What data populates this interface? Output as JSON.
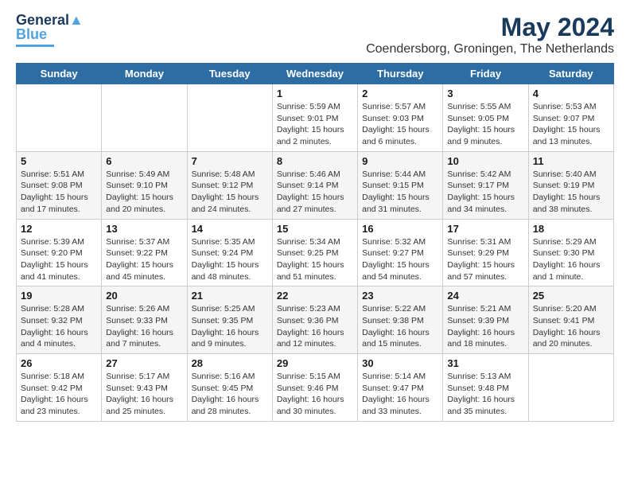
{
  "logo": {
    "line1": "General",
    "line2": "Blue"
  },
  "title": "May 2024",
  "subtitle": "Coendersborg, Groningen, The Netherlands",
  "days_of_week": [
    "Sunday",
    "Monday",
    "Tuesday",
    "Wednesday",
    "Thursday",
    "Friday",
    "Saturday"
  ],
  "weeks": [
    [
      {
        "day": "",
        "info": ""
      },
      {
        "day": "",
        "info": ""
      },
      {
        "day": "",
        "info": ""
      },
      {
        "day": "1",
        "info": "Sunrise: 5:59 AM\nSunset: 9:01 PM\nDaylight: 15 hours\nand 2 minutes."
      },
      {
        "day": "2",
        "info": "Sunrise: 5:57 AM\nSunset: 9:03 PM\nDaylight: 15 hours\nand 6 minutes."
      },
      {
        "day": "3",
        "info": "Sunrise: 5:55 AM\nSunset: 9:05 PM\nDaylight: 15 hours\nand 9 minutes."
      },
      {
        "day": "4",
        "info": "Sunrise: 5:53 AM\nSunset: 9:07 PM\nDaylight: 15 hours\nand 13 minutes."
      }
    ],
    [
      {
        "day": "5",
        "info": "Sunrise: 5:51 AM\nSunset: 9:08 PM\nDaylight: 15 hours\nand 17 minutes."
      },
      {
        "day": "6",
        "info": "Sunrise: 5:49 AM\nSunset: 9:10 PM\nDaylight: 15 hours\nand 20 minutes."
      },
      {
        "day": "7",
        "info": "Sunrise: 5:48 AM\nSunset: 9:12 PM\nDaylight: 15 hours\nand 24 minutes."
      },
      {
        "day": "8",
        "info": "Sunrise: 5:46 AM\nSunset: 9:14 PM\nDaylight: 15 hours\nand 27 minutes."
      },
      {
        "day": "9",
        "info": "Sunrise: 5:44 AM\nSunset: 9:15 PM\nDaylight: 15 hours\nand 31 minutes."
      },
      {
        "day": "10",
        "info": "Sunrise: 5:42 AM\nSunset: 9:17 PM\nDaylight: 15 hours\nand 34 minutes."
      },
      {
        "day": "11",
        "info": "Sunrise: 5:40 AM\nSunset: 9:19 PM\nDaylight: 15 hours\nand 38 minutes."
      }
    ],
    [
      {
        "day": "12",
        "info": "Sunrise: 5:39 AM\nSunset: 9:20 PM\nDaylight: 15 hours\nand 41 minutes."
      },
      {
        "day": "13",
        "info": "Sunrise: 5:37 AM\nSunset: 9:22 PM\nDaylight: 15 hours\nand 45 minutes."
      },
      {
        "day": "14",
        "info": "Sunrise: 5:35 AM\nSunset: 9:24 PM\nDaylight: 15 hours\nand 48 minutes."
      },
      {
        "day": "15",
        "info": "Sunrise: 5:34 AM\nSunset: 9:25 PM\nDaylight: 15 hours\nand 51 minutes."
      },
      {
        "day": "16",
        "info": "Sunrise: 5:32 AM\nSunset: 9:27 PM\nDaylight: 15 hours\nand 54 minutes."
      },
      {
        "day": "17",
        "info": "Sunrise: 5:31 AM\nSunset: 9:29 PM\nDaylight: 15 hours\nand 57 minutes."
      },
      {
        "day": "18",
        "info": "Sunrise: 5:29 AM\nSunset: 9:30 PM\nDaylight: 16 hours\nand 1 minute."
      }
    ],
    [
      {
        "day": "19",
        "info": "Sunrise: 5:28 AM\nSunset: 9:32 PM\nDaylight: 16 hours\nand 4 minutes."
      },
      {
        "day": "20",
        "info": "Sunrise: 5:26 AM\nSunset: 9:33 PM\nDaylight: 16 hours\nand 7 minutes."
      },
      {
        "day": "21",
        "info": "Sunrise: 5:25 AM\nSunset: 9:35 PM\nDaylight: 16 hours\nand 9 minutes."
      },
      {
        "day": "22",
        "info": "Sunrise: 5:23 AM\nSunset: 9:36 PM\nDaylight: 16 hours\nand 12 minutes."
      },
      {
        "day": "23",
        "info": "Sunrise: 5:22 AM\nSunset: 9:38 PM\nDaylight: 16 hours\nand 15 minutes."
      },
      {
        "day": "24",
        "info": "Sunrise: 5:21 AM\nSunset: 9:39 PM\nDaylight: 16 hours\nand 18 minutes."
      },
      {
        "day": "25",
        "info": "Sunrise: 5:20 AM\nSunset: 9:41 PM\nDaylight: 16 hours\nand 20 minutes."
      }
    ],
    [
      {
        "day": "26",
        "info": "Sunrise: 5:18 AM\nSunset: 9:42 PM\nDaylight: 16 hours\nand 23 minutes."
      },
      {
        "day": "27",
        "info": "Sunrise: 5:17 AM\nSunset: 9:43 PM\nDaylight: 16 hours\nand 25 minutes."
      },
      {
        "day": "28",
        "info": "Sunrise: 5:16 AM\nSunset: 9:45 PM\nDaylight: 16 hours\nand 28 minutes."
      },
      {
        "day": "29",
        "info": "Sunrise: 5:15 AM\nSunset: 9:46 PM\nDaylight: 16 hours\nand 30 minutes."
      },
      {
        "day": "30",
        "info": "Sunrise: 5:14 AM\nSunset: 9:47 PM\nDaylight: 16 hours\nand 33 minutes."
      },
      {
        "day": "31",
        "info": "Sunrise: 5:13 AM\nSunset: 9:48 PM\nDaylight: 16 hours\nand 35 minutes."
      },
      {
        "day": "",
        "info": ""
      }
    ]
  ]
}
